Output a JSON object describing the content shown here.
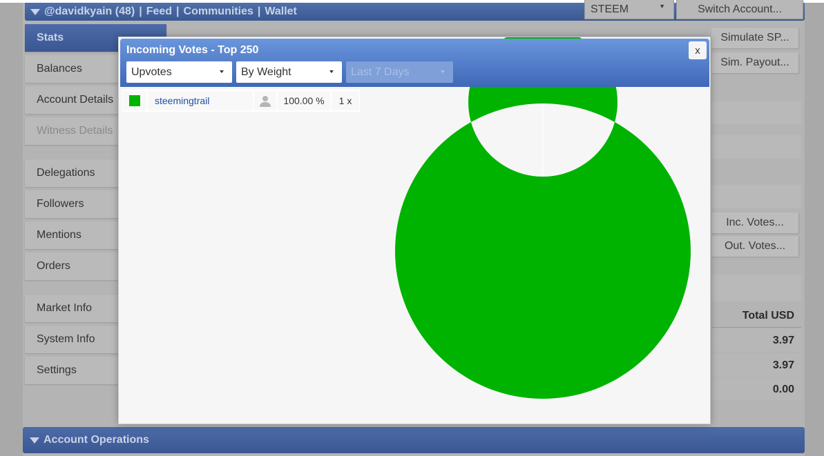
{
  "header": {
    "account": "@davidkyain (48)",
    "nav": [
      "Feed",
      "Communities",
      "Wallet"
    ],
    "currency_select": "STEEM",
    "switch_account": "Switch Account..."
  },
  "sidebar": {
    "items": [
      {
        "label": "Stats",
        "state": "active"
      },
      {
        "label": "Balances"
      },
      {
        "label": "Account Details"
      },
      {
        "label": "Witness Details",
        "state": "disabled"
      },
      {
        "label": "Delegations"
      },
      {
        "label": "Followers"
      },
      {
        "label": "Mentions"
      },
      {
        "label": "Orders"
      },
      {
        "label": "Market Info"
      },
      {
        "label": "System Info"
      },
      {
        "label": "Settings"
      }
    ]
  },
  "right": {
    "buttons": [
      "Simulate SP...",
      "Sim. Payout...",
      "Inc. Votes...",
      "Out. Votes..."
    ],
    "table_header": "Total USD",
    "values": [
      "3.97",
      "3.97",
      "0.00"
    ]
  },
  "bottom": {
    "title": "Account Operations"
  },
  "modal": {
    "title": "Incoming Votes - Top 250",
    "close": "x",
    "filters": {
      "type": "Upvotes",
      "sort": "By Weight",
      "period": "Last 7 Days"
    },
    "votes": [
      {
        "name": "steemingtrail",
        "percent": "100.00 %",
        "count": "1 x",
        "color": "#00b300",
        "icon": "user-icon"
      }
    ]
  },
  "chart_data": {
    "type": "pie",
    "donut": true,
    "categories": [
      "steemingtrail"
    ],
    "values": [
      100
    ],
    "colors": [
      "#00b300"
    ]
  }
}
